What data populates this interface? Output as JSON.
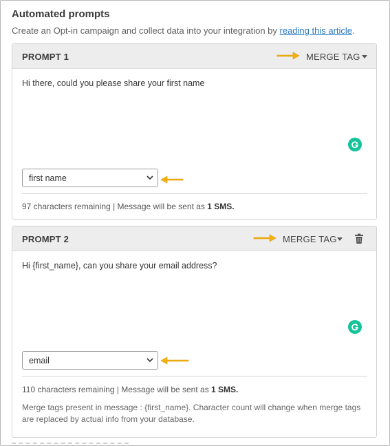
{
  "section": {
    "title": "Automated prompts",
    "subtitle_prefix": "Create an Opt-in campaign and collect data into your integration by ",
    "subtitle_link": "reading this article",
    "subtitle_suffix": "."
  },
  "colors": {
    "arrow": "#f2b111",
    "grammarly": "#15c39a",
    "link": "#2a79c0"
  },
  "prompts": [
    {
      "title": "PROMPT 1",
      "merge_tag_label": "MERGE TAG",
      "message": "Hi there, could you please share your first name",
      "field_value": "first name",
      "chars_remaining": "97 characters remaining | Message will be sent as ",
      "sms_count": "1 SMS.",
      "icons": [
        "arrow-icon",
        "caret-down-icon",
        "grammarly-icon",
        "chevron-down-icon"
      ]
    },
    {
      "title": "PROMPT 2",
      "merge_tag_label": "MERGE TAG",
      "message": "Hi {first_name}, can you share your email address?",
      "field_value": "email",
      "chars_remaining": "110 characters remaining | Message will be sent as ",
      "sms_count": "1 SMS.",
      "note": "Merge tags present in message : {first_name}. Character count will change when merge tags are replaced by actual info from your database.",
      "icons": [
        "arrow-icon",
        "caret-down-icon",
        "trash-icon",
        "grammarly-icon",
        "chevron-down-icon"
      ]
    }
  ]
}
